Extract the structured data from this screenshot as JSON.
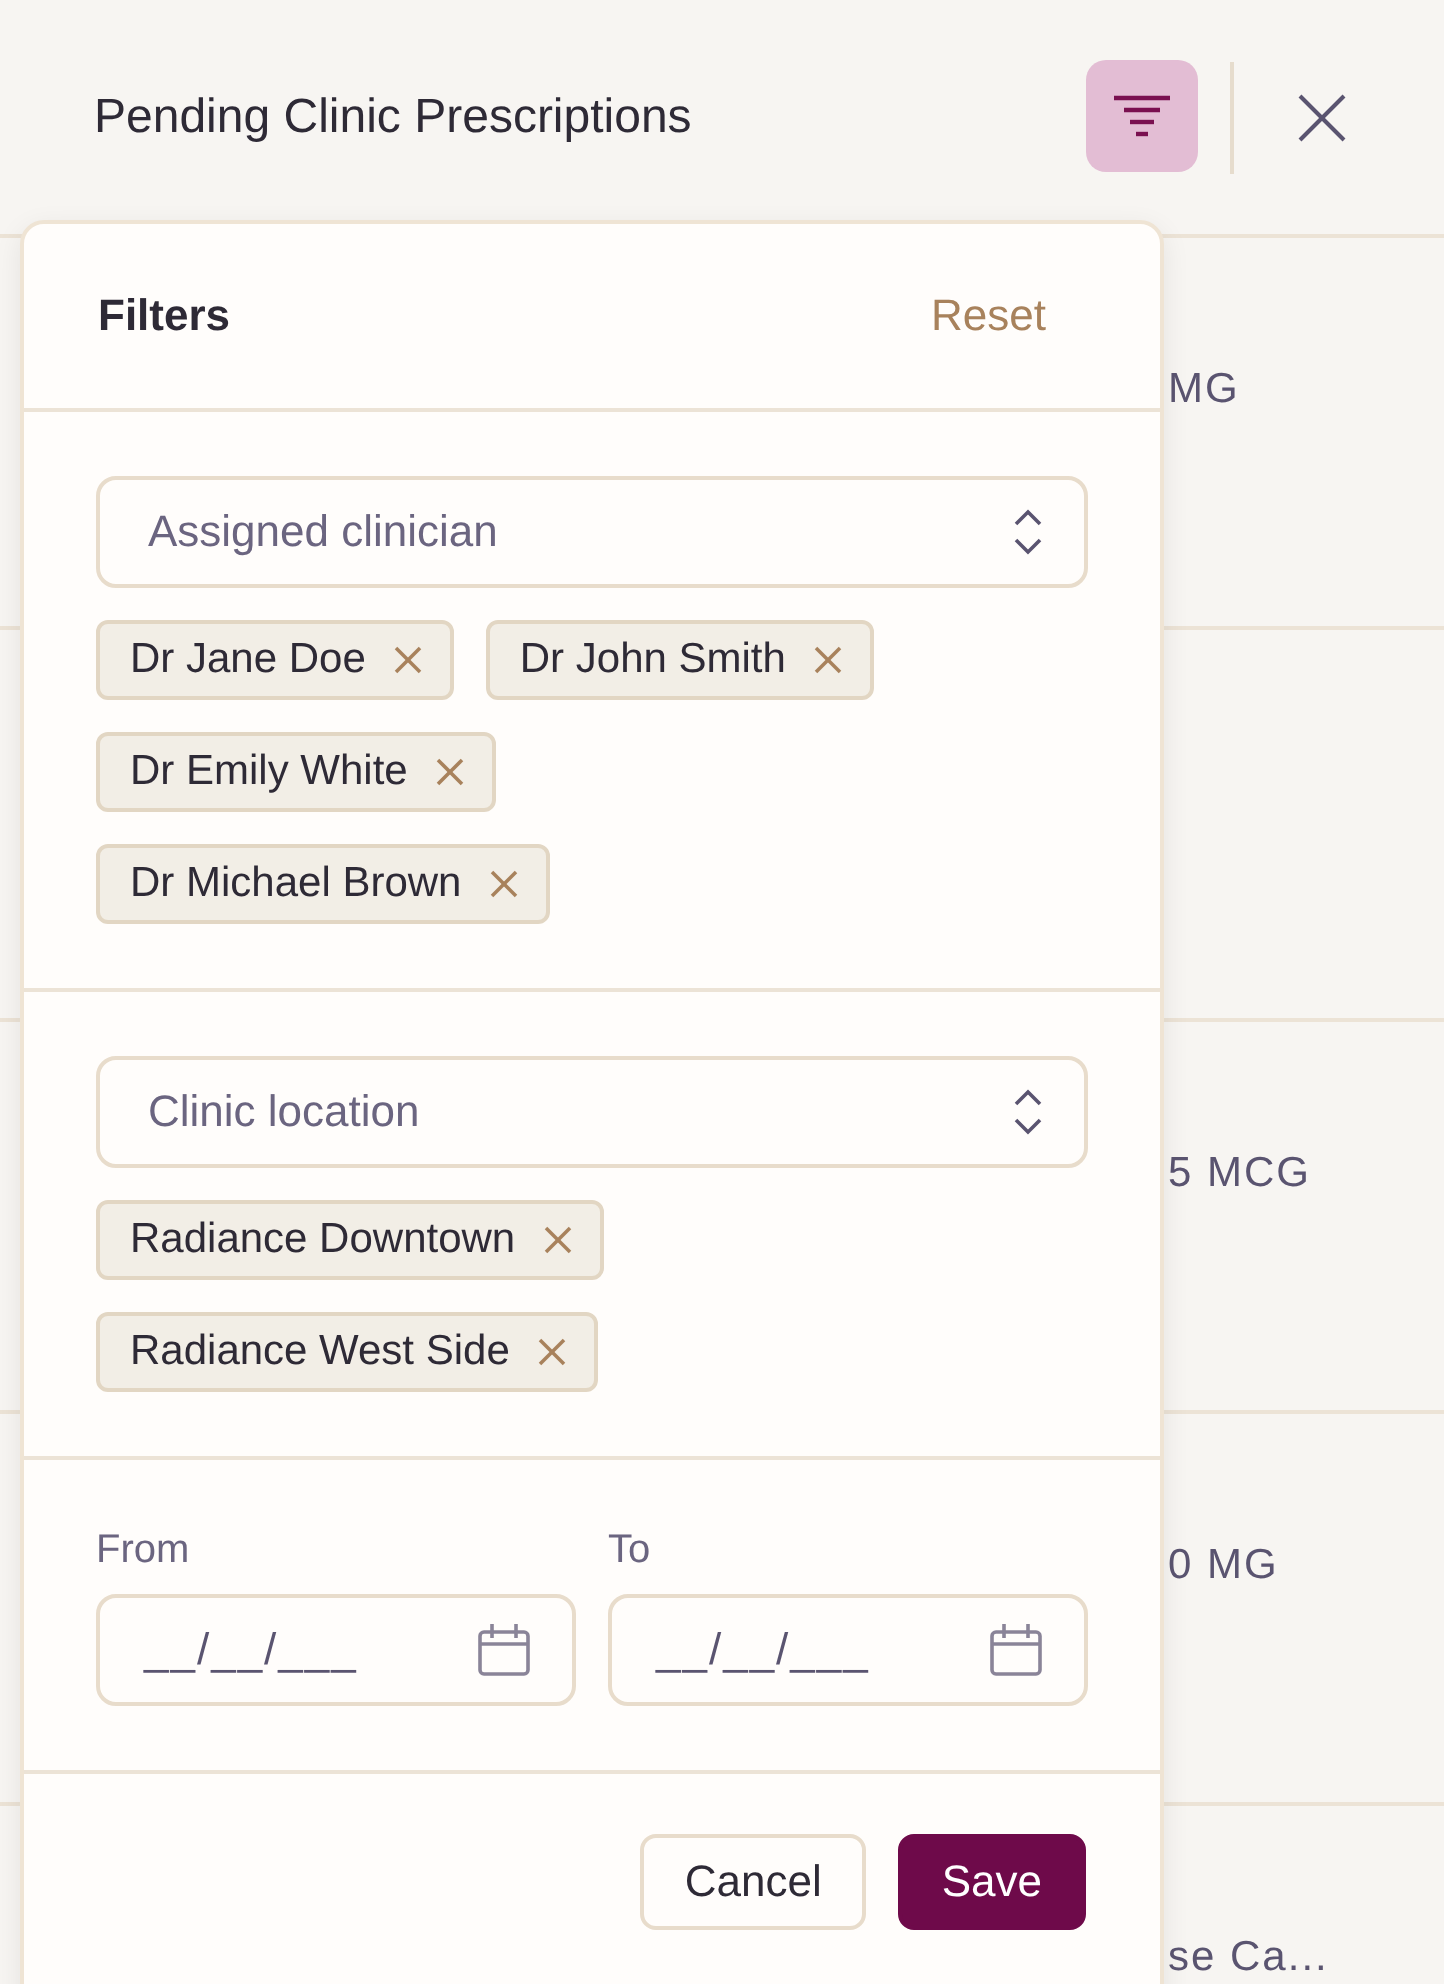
{
  "header": {
    "title": "Pending Clinic Prescriptions",
    "filter_active": true
  },
  "rows": [
    {
      "cell": "MG"
    },
    {
      "cell": ""
    },
    {
      "cell": "5 MCG"
    },
    {
      "cell": "0 MG"
    },
    {
      "cell": "se Ca..."
    }
  ],
  "filters": {
    "title": "Filters",
    "reset": "Reset",
    "selects": [
      {
        "placeholder": "Assigned clinician",
        "tags": [
          "Dr Jane Doe",
          "Dr John Smith",
          "Dr Emily White",
          "Dr Michael Brown"
        ]
      },
      {
        "placeholder": "Clinic location",
        "tags": [
          "Radiance Downtown",
          "Radiance West Side"
        ]
      }
    ],
    "dates": [
      {
        "label": "From",
        "placeholder": "__/__/___"
      },
      {
        "label": "To",
        "placeholder": "__/__/___"
      }
    ],
    "buttons": [
      {
        "label": "Cancel",
        "kind": "secondary"
      },
      {
        "label": "Save",
        "kind": "primary"
      }
    ]
  }
}
